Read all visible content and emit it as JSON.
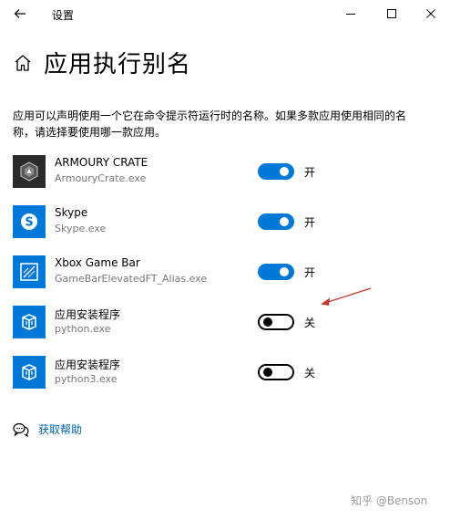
{
  "window": {
    "title": "设置"
  },
  "header": {
    "title": "应用执行别名"
  },
  "description": "应用可以声明使用一个它在命令提示符运行时的名称。如果多款应用使用相同的名称，请选择要使用哪一款应用。",
  "apps": [
    {
      "name": "ARMOURY CRATE",
      "exe": "ArmouryCrate.exe",
      "enabled": true,
      "state_label": "开",
      "icon": "armoury-crate-icon",
      "icon_bg": "#2b2b2b"
    },
    {
      "name": "Skype",
      "exe": "Skype.exe",
      "enabled": true,
      "state_label": "开",
      "icon": "skype-icon",
      "icon_bg": "#0078d7"
    },
    {
      "name": "Xbox Game Bar",
      "exe": "GameBarElevatedFT_Alias.exe",
      "enabled": true,
      "state_label": "开",
      "icon": "xbox-game-bar-icon",
      "icon_bg": "#0078d7"
    },
    {
      "name": "应用安装程序",
      "exe": "python.exe",
      "enabled": false,
      "state_label": "关",
      "icon": "app-installer-icon",
      "icon_bg": "#0078d7"
    },
    {
      "name": "应用安装程序",
      "exe": "python3.exe",
      "enabled": false,
      "state_label": "关",
      "icon": "app-installer-icon",
      "icon_bg": "#0078d7"
    }
  ],
  "help": {
    "label": "获取帮助"
  },
  "watermark": "知乎 @Benson",
  "colors": {
    "accent": "#0078d7",
    "link": "#0063b1",
    "annotation_arrow": "#c0392b"
  }
}
